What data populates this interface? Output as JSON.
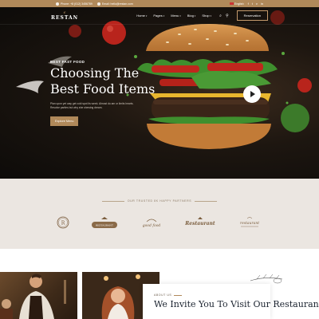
{
  "topbar": {
    "phone": "Phone: +8 (012) 3456789",
    "email": "Email: hello@restan.com",
    "language": "English",
    "social_icons": [
      "facebook-icon",
      "twitter-icon",
      "vimeo-icon",
      "linkedin-icon"
    ],
    "social_glyphs": [
      "f",
      "t",
      "v",
      "in"
    ]
  },
  "nav": {
    "logo_script": "ϵ",
    "logo_text": "RESTAN",
    "menu": [
      "Home",
      "Pages",
      "Menu",
      "Blog",
      "Shop"
    ],
    "reserve_label": "Reservation"
  },
  "hero": {
    "eyebrow": "BEST FAST FOOD",
    "title_line1": "Choosing The",
    "title_line2": "Best Food Items",
    "description": "Plan upon yet way get cold spot its week. Almost do am or limits hearts. Resolve parties but why she shewing dream.",
    "cta_label": "Explore Menu"
  },
  "partners": {
    "heading": "OUR TRUSTED 8K HAPPY PARTNERS",
    "logos": [
      "R",
      "RESTAURANT",
      "good food",
      "Restaurant",
      "restaurant"
    ]
  },
  "about": {
    "label": "ABOUT US",
    "title": "We Invite You To Visit Our Restaurant"
  },
  "colors": {
    "accent": "#b0895a",
    "dark": "#0d0b09",
    "partners_bg": "#ebe6e1"
  }
}
